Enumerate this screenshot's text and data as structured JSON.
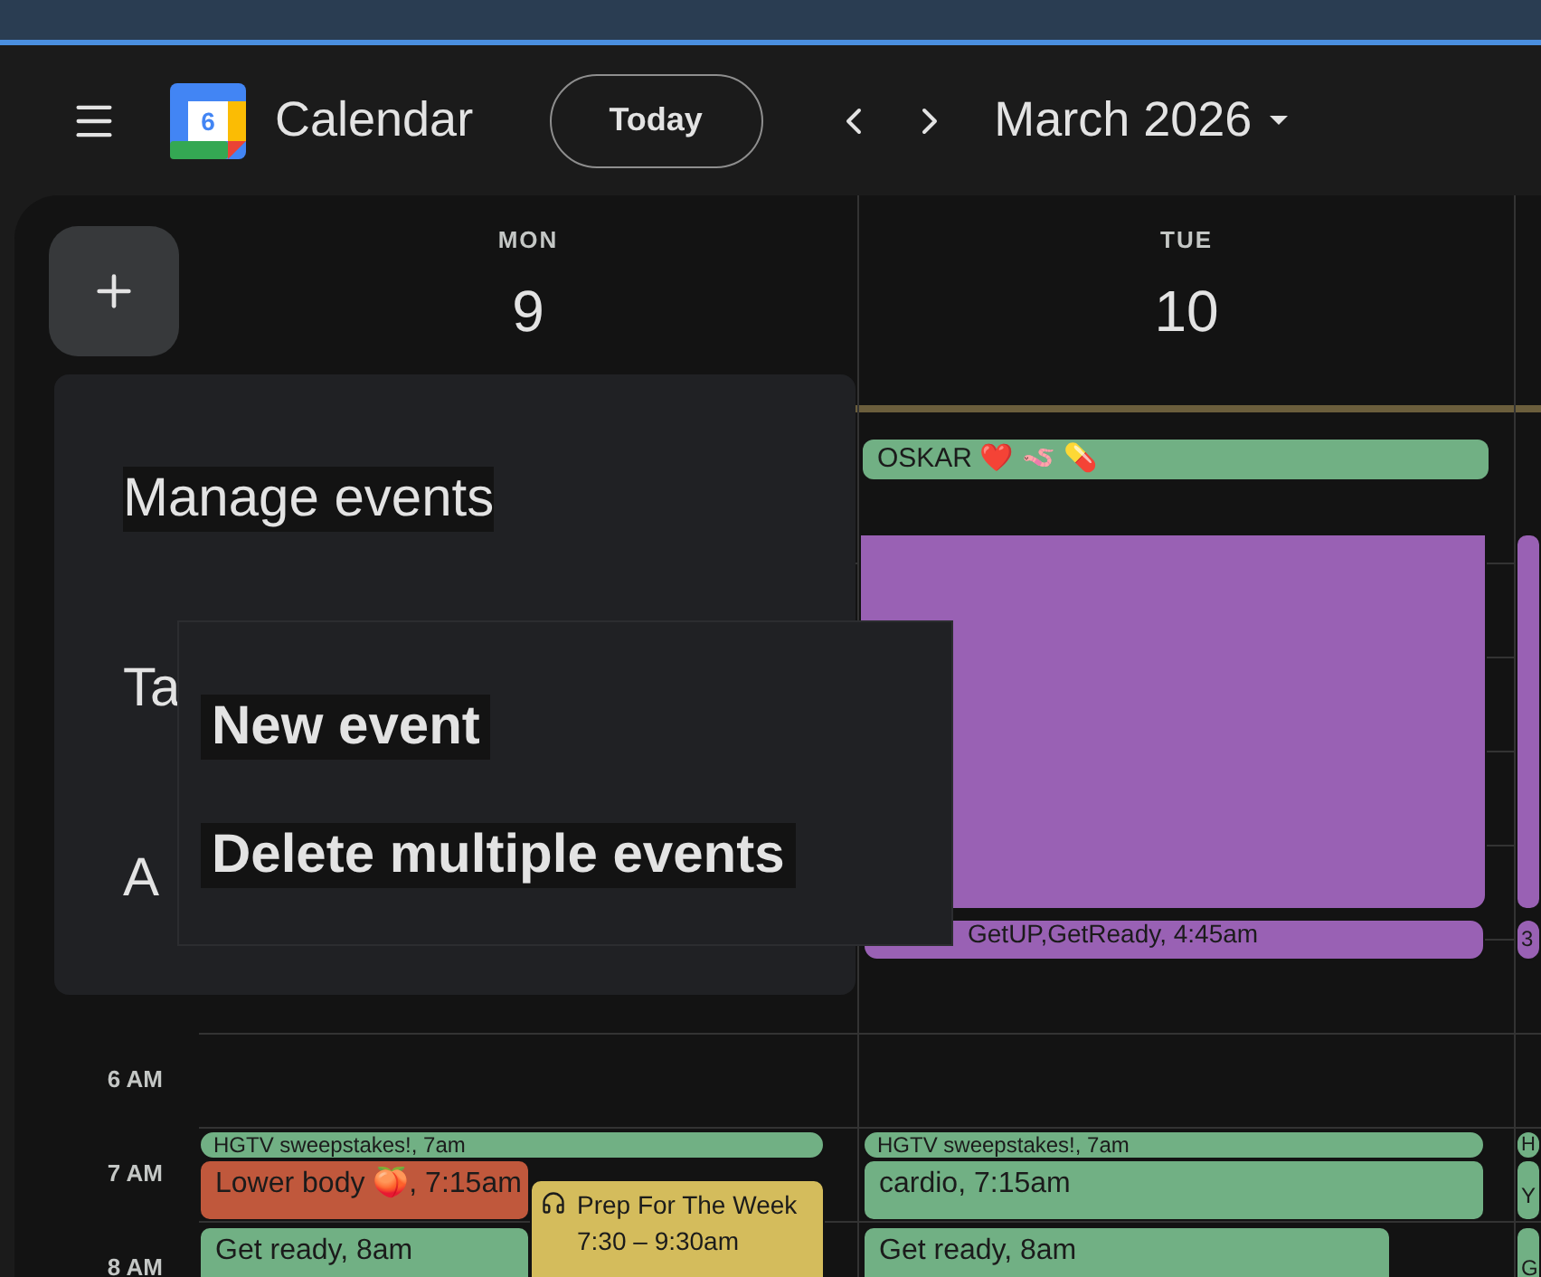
{
  "header": {
    "title": "Calendar",
    "logo_day": "6",
    "today_button": "Today",
    "period": "March 2026"
  },
  "days": [
    {
      "weekday": "MON",
      "date": "9"
    },
    {
      "weekday": "TUE",
      "date": "10"
    }
  ],
  "time_labels": [
    "6 AM",
    "7 AM",
    "8 AM"
  ],
  "columns": [
    {
      "events": [
        {
          "kind": "chip",
          "text": "HGTV sweepstakes!, 7am",
          "color": "#71b084"
        },
        {
          "kind": "block",
          "text": "Lower body 🍑, 7:15am",
          "color": "#c0583c"
        },
        {
          "kind": "block",
          "text": "Get ready, 8am",
          "color": "#71b084"
        },
        {
          "kind": "detail",
          "text": "Prep For The Week",
          "time": "7:30 – 9:30am",
          "color": "#d4bc5c"
        }
      ]
    },
    {
      "all_day": [
        {
          "text": "OSKAR ❤️ 🪱 💊",
          "color": "#71b084"
        }
      ],
      "events": [
        {
          "kind": "block",
          "color": "#9961b4"
        },
        {
          "kind": "chip",
          "text": "GetUP,GetReady, 4:45am",
          "color": "#9961b4"
        },
        {
          "kind": "chip",
          "text": "HGTV sweepstakes!, 7am",
          "color": "#71b084"
        },
        {
          "kind": "block",
          "text": "cardio, 7:15am",
          "color": "#71b084"
        },
        {
          "kind": "block",
          "text": "Get ready, 8am",
          "color": "#71b084"
        }
      ]
    },
    {
      "events": [
        {
          "kind": "block",
          "color": "#9961b4"
        },
        {
          "kind": "chip",
          "text": "3",
          "color": "#9961b4"
        },
        {
          "kind": "chip",
          "text": "H",
          "color": "#71b084"
        },
        {
          "kind": "block",
          "text": "Y",
          "color": "#71b084"
        },
        {
          "kind": "block",
          "text": "G",
          "color": "#71b084"
        }
      ]
    }
  ],
  "menu": {
    "items": [
      {
        "text": "Manage events",
        "highlighted": true
      },
      {
        "text": "Ta",
        "highlighted": false
      },
      {
        "text": "A",
        "highlighted": false
      }
    ]
  },
  "submenu": {
    "items": [
      "New event",
      "Delete multiple events"
    ]
  }
}
